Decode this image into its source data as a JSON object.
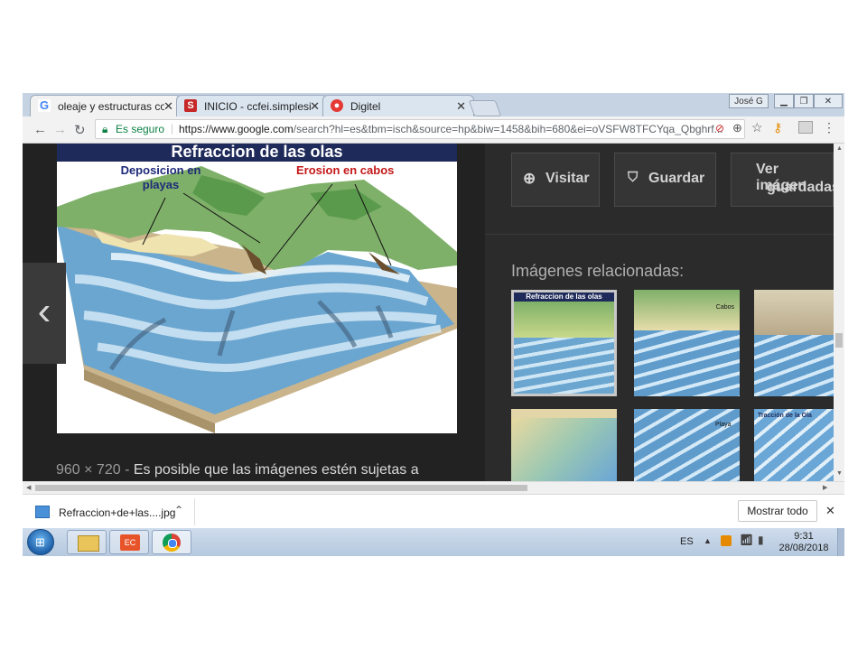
{
  "tabs": [
    {
      "title": "oleaje y estructuras coste",
      "favicon": "google-icon",
      "active": true
    },
    {
      "title": "INICIO - ccfei.simplesite.c",
      "favicon": "simplesite-icon",
      "active": false
    },
    {
      "title": "Digitel",
      "favicon": "digitel-icon",
      "active": false
    }
  ],
  "window": {
    "user_label": "José G"
  },
  "address": {
    "secure_label": "Es seguro",
    "url_host": "https://www.google.com",
    "url_path": "/search?hl=es&tbm=isch&source=hp&biw=1458&bih=680&ei=oVSFW8TFCYqa_Qbghrf..."
  },
  "figure": {
    "title": "Refraccion de las olas",
    "deposition_label": "Deposicion en playas",
    "erosion_label": "Erosion en cabos"
  },
  "image_info": {
    "dimensions": "960 × 720",
    "separator": "-",
    "note": "Es posible que las imágenes estén sujetas a"
  },
  "actions": {
    "visit": "Visitar",
    "save": "Guardar",
    "view_saved_line1": "Ver imágen",
    "view_saved_line2": "guardadas"
  },
  "related": {
    "title": "Imágenes relacionadas:",
    "thumbs": [
      {
        "caption": "Refraccion de las olas"
      },
      {
        "caption": "Cabos"
      },
      {
        "caption": ""
      },
      {
        "caption": ""
      },
      {
        "caption": "Playa"
      },
      {
        "caption": "Tracción de la Ola"
      }
    ]
  },
  "download": {
    "filename": "Refraccion+de+las....jpg",
    "show_all": "Mostrar todo"
  },
  "taskbar": {
    "lang": "ES",
    "time": "9:31",
    "date": "28/08/2018"
  },
  "colors": {
    "accent_blue": "#1a73e8",
    "secure_green": "#0b8043",
    "figure_title_bg": "#1e2a5a"
  }
}
